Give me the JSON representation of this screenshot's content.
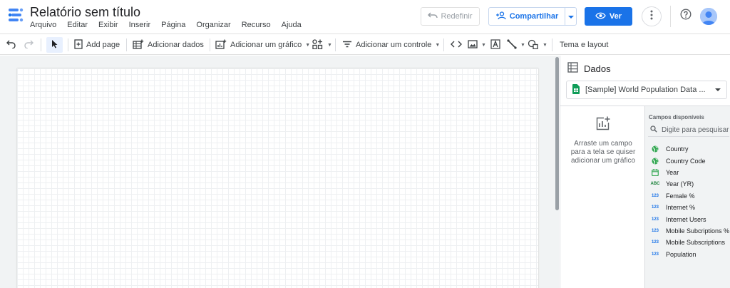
{
  "header": {
    "title": "Relatório sem título",
    "menu": [
      "Arquivo",
      "Editar",
      "Exibir",
      "Inserir",
      "Página",
      "Organizar",
      "Recurso",
      "Ajuda"
    ],
    "redo_label": "Redefinir",
    "share_label": "Compartilhar",
    "view_label": "Ver"
  },
  "toolbar": {
    "add_page": "Add page",
    "add_data": "Adicionar dados",
    "add_chart": "Adicionar um gráfico",
    "add_control": "Adicionar um controle",
    "theme": "Tema e layout"
  },
  "panel": {
    "title": "Dados",
    "data_source": "[Sample] World Population Data ...",
    "dropzone_text": "Arraste um campo para a tela se quiser adicionar um gráfico",
    "fields_heading": "Campos disponíveis",
    "search_placeholder": "Digite para pesquisar",
    "fields": [
      {
        "name": "Country",
        "type": "geo"
      },
      {
        "name": "Country Code",
        "type": "geo"
      },
      {
        "name": "Year",
        "type": "date"
      },
      {
        "name": "Year (YR)",
        "type": "text",
        "badge": "ABC"
      },
      {
        "name": "Female %",
        "type": "number",
        "badge": "123"
      },
      {
        "name": "Internet %",
        "type": "number",
        "badge": "123"
      },
      {
        "name": "Internet Users",
        "type": "number",
        "badge": "123"
      },
      {
        "name": "Mobile Subcriptions %",
        "type": "number",
        "badge": "123"
      },
      {
        "name": "Mobile Subscriptions",
        "type": "number",
        "badge": "123"
      },
      {
        "name": "Population",
        "type": "number",
        "badge": "123"
      }
    ]
  },
  "colors": {
    "accent": "#1a73e8",
    "field_dimension": "#34a853",
    "field_metric": "#1a73e8"
  }
}
